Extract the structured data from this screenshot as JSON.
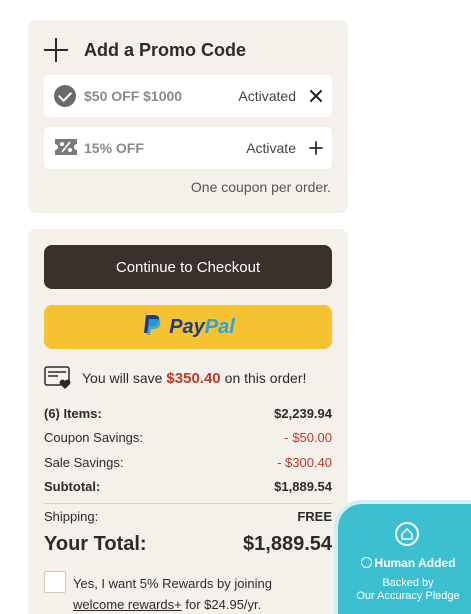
{
  "promo": {
    "title": "Add a Promo Code",
    "coupons": [
      {
        "label": "$50 OFF $1000",
        "status": "Activated",
        "action_icon": "close-icon"
      },
      {
        "label": "15% OFF",
        "status": "Activate",
        "action_icon": "plus-icon"
      }
    ],
    "note": "One coupon per order."
  },
  "summary": {
    "checkout_label": "Continue to Checkout",
    "paypal_pay": "Pay",
    "paypal_pal": "Pal",
    "savings_prefix": "You will save",
    "savings_amount": "$350.40",
    "savings_suffix": "on this order!",
    "lines": {
      "items_label": "(6) Items:",
      "items_value": "$2,239.94",
      "coupon_label": "Coupon Savings:",
      "coupon_value": "- $50.00",
      "sale_label": "Sale Savings:",
      "sale_value": "- $300.40",
      "subtotal_label": "Subtotal:",
      "subtotal_value": "$1,889.54",
      "shipping_label": "Shipping:",
      "shipping_value": "FREE"
    },
    "total_label": "Your Total:",
    "total_value": "$1,889.54",
    "rewards_text_1": "Yes, I want 5% Rewards by joining",
    "rewards_link": "welcome rewards+",
    "rewards_text_2": "for $24.95/yr."
  },
  "badge": {
    "title": "Human Added",
    "sub_1": "Backed by",
    "sub_2": "Our Accuracy Pledge"
  },
  "colors": {
    "card_bg": "#f4f1ea",
    "checkout_bg": "#3a302c",
    "paypal_bg": "#f6c232",
    "savings_red": "#c0392b",
    "badge_bg": "#3cc0d1"
  }
}
